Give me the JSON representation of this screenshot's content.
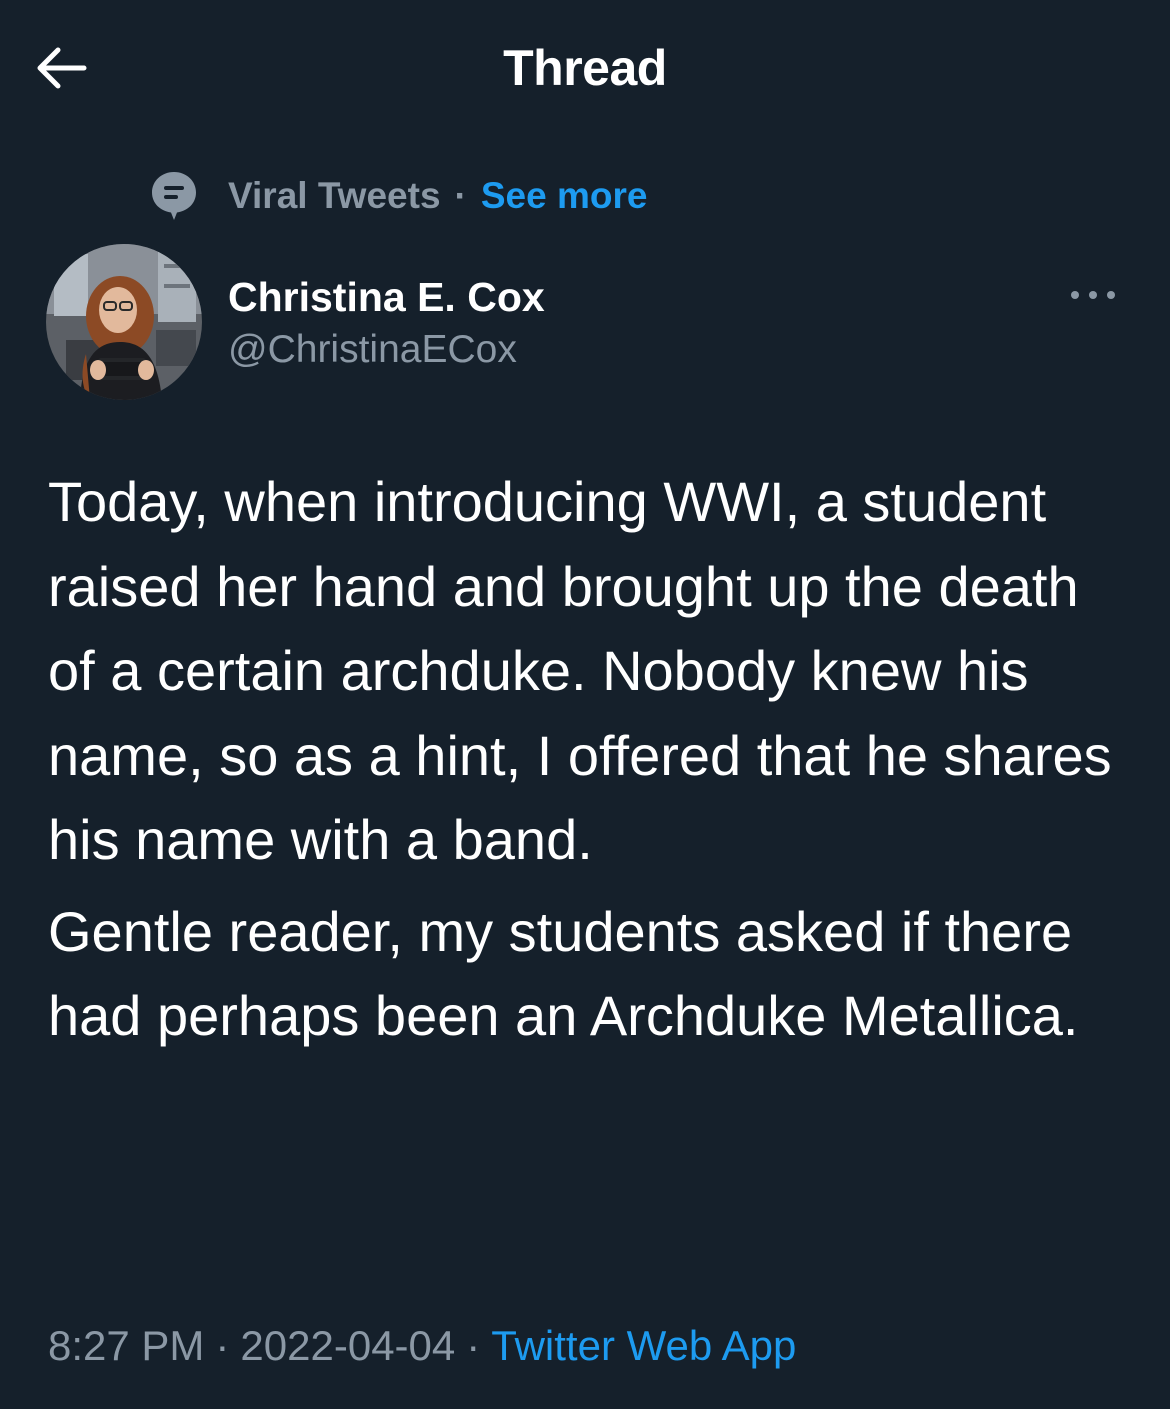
{
  "header": {
    "title": "Thread",
    "back_icon": "arrow-left-icon"
  },
  "context": {
    "icon": "speech-bubble-icon",
    "topic": "Viral Tweets",
    "separator": "·",
    "see_more": "See more"
  },
  "author": {
    "name": "Christina E. Cox",
    "handle": "@ChristinaECox",
    "avatar": "profile-photo",
    "more_icon": "more-dots-icon"
  },
  "tweet": {
    "paragraphs": [
      "Today, when introducing WWI, a student raised her hand and brought up the death of a certain archduke. Nobody knew his name, so as a hint, I offered that he shares his name with a band.",
      "Gentle reader, my students asked if there had perhaps been an Archduke Metallica."
    ]
  },
  "meta": {
    "time": "8:27 PM",
    "date": "2022-04-04",
    "source": "Twitter Web App",
    "separator": "·"
  },
  "colors": {
    "background": "#15202b",
    "text": "#ffffff",
    "secondary": "#8b98a5",
    "accent": "#1d9bf0"
  }
}
